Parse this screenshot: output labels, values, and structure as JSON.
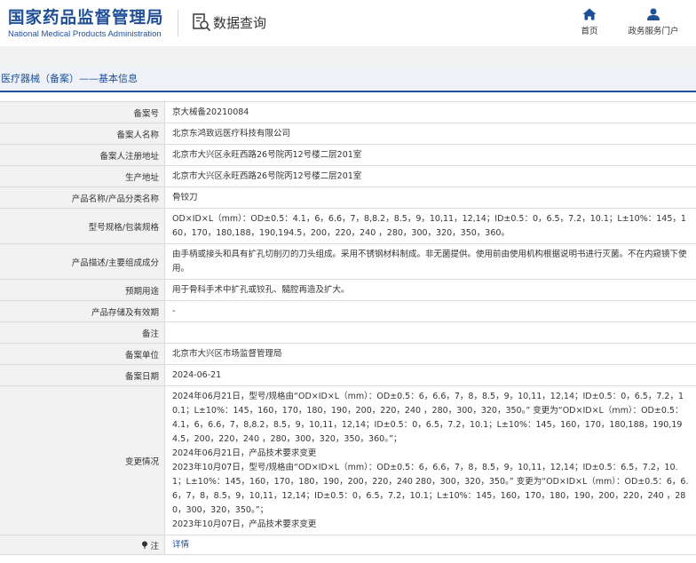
{
  "header": {
    "logo_cn": "国家药品监督管理局",
    "logo_en": "National Medical Products Administration",
    "query_label": "数据查询",
    "nav": [
      {
        "label": "首页",
        "icon": "home-icon"
      },
      {
        "label": "政务服务门户",
        "icon": "user-icon"
      }
    ]
  },
  "colors": {
    "brand": "#1f4f97",
    "label_bg": "#f2f2f2",
    "border": "#dcdcdc"
  },
  "section_title": "医疗器械（备案）——基本信息",
  "rows": [
    {
      "key": "备案号",
      "value": "京大械备20210084"
    },
    {
      "key": "备案人名称",
      "value": "北京东鸿致远医疗科技有限公司"
    },
    {
      "key": "备案人注册地址",
      "value": "北京市大兴区永旺西路26号院丙12号楼二层201室"
    },
    {
      "key": "生产地址",
      "value": "北京市大兴区永旺西路26号院丙12号楼二层201室"
    },
    {
      "key": "产品名称/产品分类名称",
      "value": "骨铰刀"
    },
    {
      "key": "型号规格/包装规格",
      "value": "OD×ID×L（mm）：OD±0.5：4.1，6，6.6，7，8,8.2，8.5，9，10,11，12,14；ID±0.5：0，6.5，7.2，10.1；L±10%：145，160，170，180,188，190,194.5，200，220，240 ，280，300，320，350，360。"
    },
    {
      "key": "产品描述/主要组成成分",
      "value": "由手柄或接头和具有扩孔切削刃的刀头组成。采用不锈钢材料制成。非无菌提供。使用前由使用机构根据说明书进行灭菌。不在内窥镜下使用。"
    },
    {
      "key": "预期用途",
      "value": "用于骨科手术中扩孔或铰孔、髓腔再造及扩大。"
    },
    {
      "key": "产品存储及有效期",
      "value": "-"
    },
    {
      "key": "备注",
      "value": ""
    },
    {
      "key": "备案单位",
      "value": "北京市大兴区市场监督管理局"
    },
    {
      "key": "备案日期",
      "value": "2024-06-21"
    }
  ],
  "change_row": {
    "key": "变更情况",
    "lines": [
      "2024年06月21日，型号/规格由“OD×ID×L（mm）：OD±0.5：6，6.6，7，8，8.5，9，10,11，12,14；ID±0.5：0，6.5，7.2，10.1；L±10%：145，160，170，180，190，200，220，240 ，280，300，320，350。” 变更为“OD×ID×L（mm）：OD±0.5：4.1，6，6.6，7，8,8.2，8.5，9，10,11，12,14；ID±0.5：0，6.5，7.2，10.1；L±10%：145，160，170，180,188，190,194.5，200，220，240 ，280，300，320，350，360。”；",
      "2024年06月21日，产品技术要求变更",
      "2023年10月07日，型号/规格由“OD×ID×L（mm）：OD±0.5：6，6.6，7，8，8.5，9，10,11，12,14；ID±0.5：6.5，7.2，10.1；L±10%：145，160，170，180，190，200，220，240 280，300，320，350。” 变更为“OD×ID×L（mm）：OD±0.5：6，6.6，7，8，8.5，9，10,11，12,14；ID±0.5：0，6.5，7.2，10.1；L±10%：145，160，170，180，190，200，220，240 ，280，300，320，350。”；",
      "2023年10月07日，产品技术要求变更"
    ]
  },
  "note_row": {
    "key": "注",
    "icon": "pin-icon",
    "link": "详情"
  }
}
